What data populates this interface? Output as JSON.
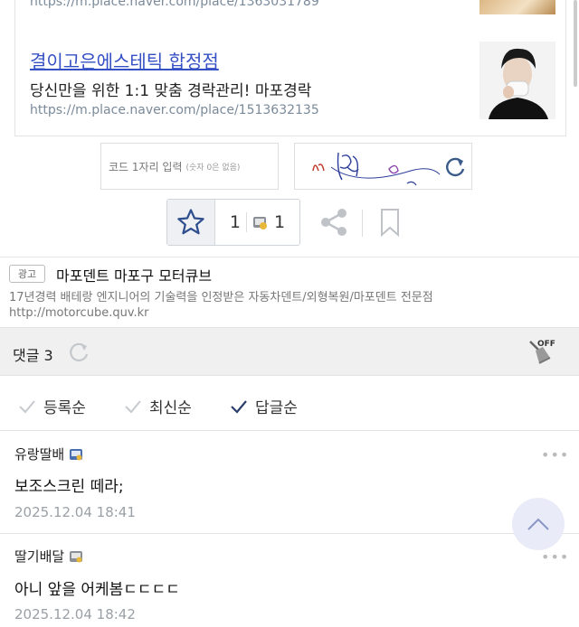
{
  "ads": [
    {
      "url": "https://m.place.naver.com/place/1363031789"
    },
    {
      "title": "결이고은에스테틱 합정점",
      "desc": "당신만을 위한 1:1 맞춤 경락관리! 마포경락",
      "url": "https://m.place.naver.com/place/1513632135"
    }
  ],
  "captcha": {
    "input_label": "코드 1자리 입력",
    "input_hint": "(숫자 0은 없음)"
  },
  "actions": {
    "like_count": "1",
    "comment_count": "1"
  },
  "text_ad": {
    "badge": "광고",
    "title": "마포덴트 마포구 모터큐브",
    "desc": "17년경력 배테랑 엔지니어의 기술력을 인정받은 자동차덴트/외형복원/마포덴트 전문점",
    "url": "http://motorcube.quv.kr"
  },
  "comments_header": {
    "label": "댓글 3"
  },
  "broom_badge": "OFF",
  "sort_options": [
    "등록순",
    "최신순",
    "답글순"
  ],
  "comments": [
    {
      "author": "유랑딸배",
      "text": "보조스크린 떼라;",
      "date": "2025.12.04 18:41"
    },
    {
      "author": "딸기배달",
      "text": "아니 앞을 어케봄ㄷㄷㄷㄷ",
      "date": "2025.12.04 18:42"
    }
  ],
  "colors": {
    "link": "#3550c4",
    "muted": "#9aa0a6",
    "fab": "#e9ecf8"
  }
}
